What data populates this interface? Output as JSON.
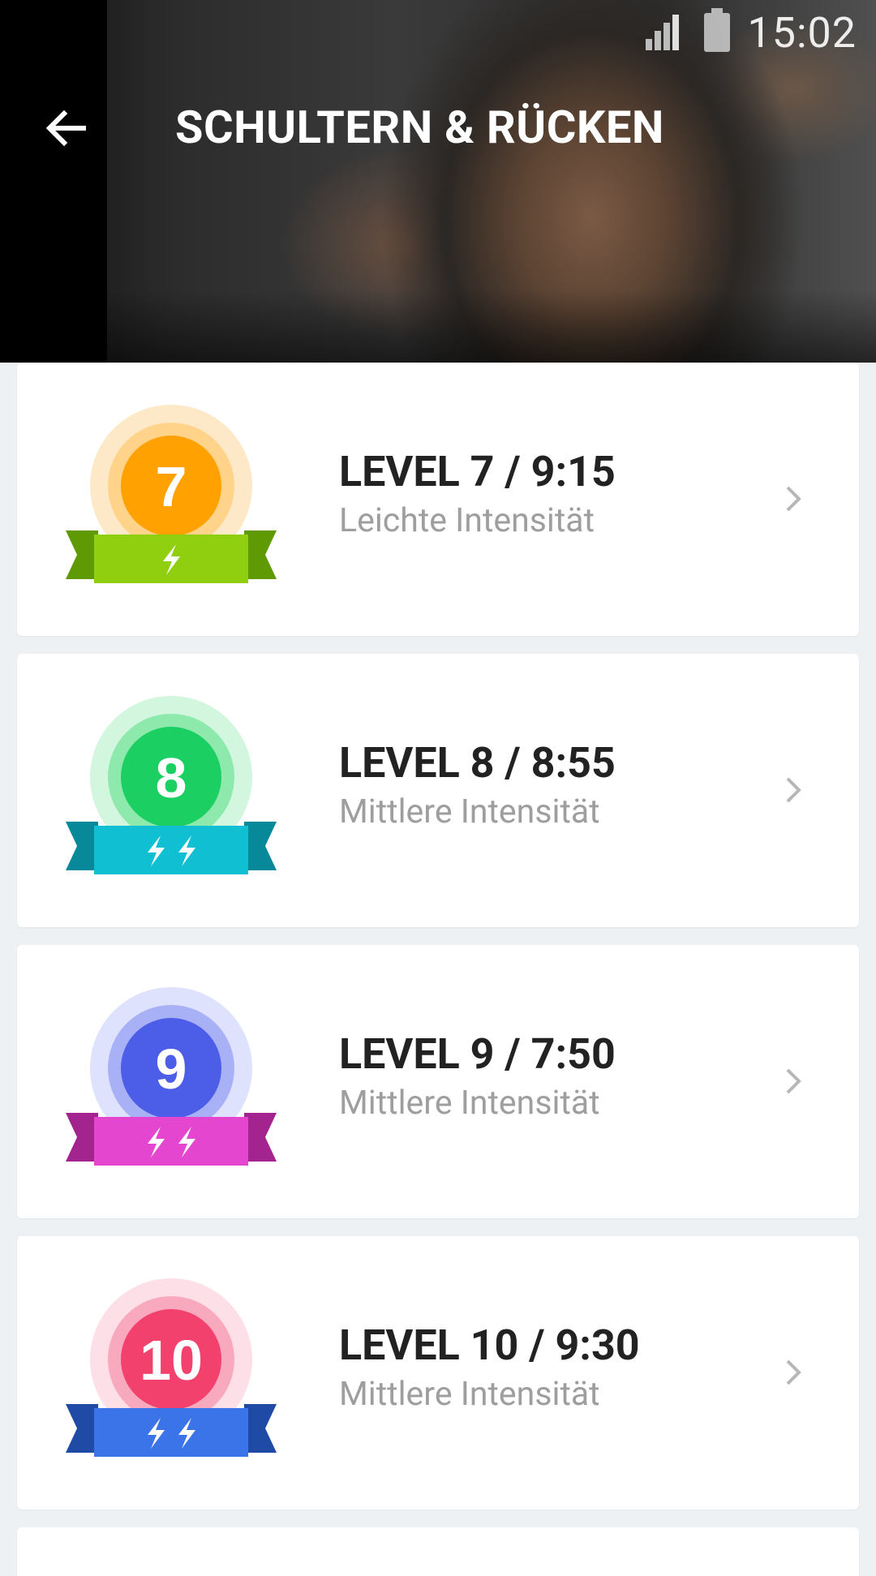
{
  "status_bar": {
    "time": "15:02"
  },
  "header": {
    "title": "SCHULTERN & RÜCKEN"
  },
  "levels": [
    {
      "title": "LEVEL 7 / 9:15",
      "subtitle": "Leichte Intensität",
      "number": "7",
      "bolts": 1,
      "colors": {
        "outer": "#fde9c8",
        "mid": "#ffd38a",
        "inner": "#ffa100",
        "ribbon": "#8fcf0f",
        "ribbon_dark": "#5f9a05"
      }
    },
    {
      "title": "LEVEL 8 / 8:55",
      "subtitle": "Mittlere Intensität",
      "number": "8",
      "bolts": 2,
      "colors": {
        "outer": "#d3f6df",
        "mid": "#8ee9ad",
        "inner": "#1ccf62",
        "ribbon": "#11bfd3",
        "ribbon_dark": "#08899a"
      }
    },
    {
      "title": "LEVEL 9 / 7:50",
      "subtitle": "Mittlere Intensität",
      "number": "9",
      "bolts": 2,
      "colors": {
        "outer": "#dfe2fd",
        "mid": "#a9b1f6",
        "inner": "#4c5de8",
        "ribbon": "#e446cf",
        "ribbon_dark": "#a3238f"
      }
    },
    {
      "title": "LEVEL 10 / 9:30",
      "subtitle": "Mittlere Intensität",
      "number": "10",
      "bolts": 2,
      "colors": {
        "outer": "#fde0e7",
        "mid": "#f9a9bd",
        "inner": "#f2416c",
        "ribbon": "#3b73e8",
        "ribbon_dark": "#1f4aa6"
      }
    }
  ],
  "icons": {
    "back": "arrow-left-icon",
    "chevron": "chevron-right-icon",
    "bolt": "lightning-bolt-icon",
    "signal": "signal-icon",
    "battery": "battery-icon"
  }
}
